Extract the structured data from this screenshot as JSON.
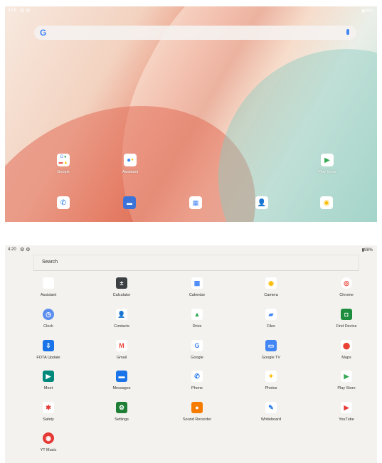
{
  "home": {
    "status": {
      "time": "4:16",
      "battery": "99%"
    },
    "apps": [
      {
        "label": "Google"
      },
      {
        "label": "Assistant"
      },
      {
        "label": "Play Store"
      }
    ]
  },
  "drawer": {
    "status": {
      "time": "4:20",
      "battery": "98%"
    },
    "search_placeholder": "Search",
    "apps": [
      {
        "label": "Assistant",
        "icon": "assistant-icon",
        "color": "#ffffff"
      },
      {
        "label": "Calculator",
        "icon": "calculator-icon",
        "color": "#3c4043"
      },
      {
        "label": "Calendar",
        "icon": "calendar-icon",
        "color": "#4285f4"
      },
      {
        "label": "Camera",
        "icon": "camera-icon",
        "color": "#fbbc04"
      },
      {
        "label": "Chrome",
        "icon": "chrome-icon",
        "color": "#ea4335"
      },
      {
        "label": "Clock",
        "icon": "clock-icon",
        "color": "#5b8def"
      },
      {
        "label": "Contacts",
        "icon": "contacts-icon",
        "color": "#1a73e8"
      },
      {
        "label": "Drive",
        "icon": "drive-icon",
        "color": "#34a853"
      },
      {
        "label": "Files",
        "icon": "files-icon",
        "color": "#4285f4"
      },
      {
        "label": "Find Device",
        "icon": "find-device-icon",
        "color": "#1e8e3e"
      },
      {
        "label": "FOTA Update",
        "icon": "fota-update-icon",
        "color": "#1a73e8"
      },
      {
        "label": "Gmail",
        "icon": "gmail-icon",
        "color": "#ea4335"
      },
      {
        "label": "Google",
        "icon": "google-icon",
        "color": "#4285f4"
      },
      {
        "label": "Google TV",
        "icon": "google-tv-icon",
        "color": "#4285f4"
      },
      {
        "label": "Maps",
        "icon": "maps-icon",
        "color": "#ea4335"
      },
      {
        "label": "Meet",
        "icon": "meet-icon",
        "color": "#00897b"
      },
      {
        "label": "Messages",
        "icon": "messages-icon",
        "color": "#1a73e8"
      },
      {
        "label": "Phone",
        "icon": "phone-icon",
        "color": "#1a73e8"
      },
      {
        "label": "Photos",
        "icon": "photos-icon",
        "color": "#fbbc04"
      },
      {
        "label": "Play Store",
        "icon": "play-store-icon",
        "color": "#34a853"
      },
      {
        "label": "Safety",
        "icon": "safety-icon",
        "color": "#e53935"
      },
      {
        "label": "Settings",
        "icon": "settings-icon",
        "color": "#1e7e34"
      },
      {
        "label": "Sound Recorder",
        "icon": "sound-recorder-icon",
        "color": "#f57c00"
      },
      {
        "label": "Whiteboard",
        "icon": "whiteboard-icon",
        "color": "#1a73e8"
      },
      {
        "label": "YouTube",
        "icon": "youtube-icon",
        "color": "#e53935"
      },
      {
        "label": "YT Music",
        "icon": "yt-music-icon",
        "color": "#e53935"
      }
    ]
  }
}
